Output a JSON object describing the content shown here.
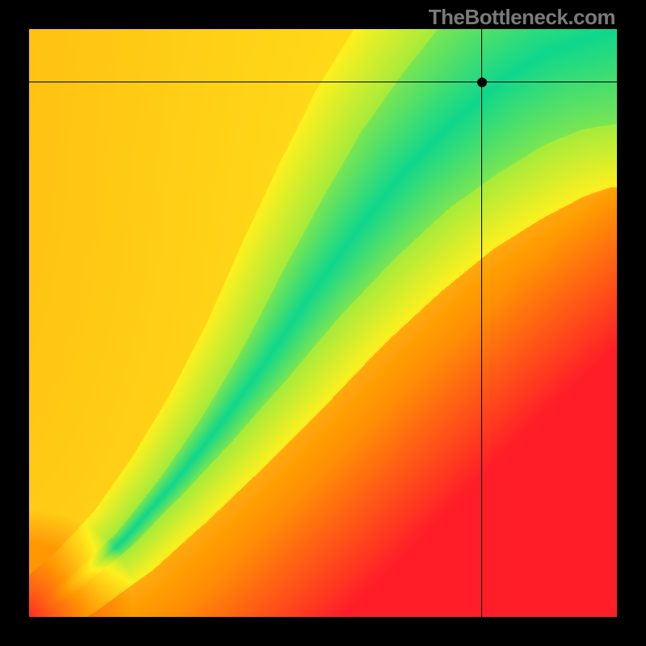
{
  "watermark": "TheBottleneck.com",
  "chart_data": {
    "type": "heatmap",
    "title": "",
    "xlabel": "",
    "ylabel": "",
    "xlim": [
      0,
      100
    ],
    "ylim": [
      0,
      100
    ],
    "grid": false,
    "legend": false,
    "colorscale_notes": "value 0 = red, 0.5 = yellow/orange, 1.0 = green (bottleneck fit). Nonlinear optimal ridge from bottom-left toward upper-center.",
    "marker": {
      "x": 77,
      "y": 91
    },
    "crosshair": {
      "x": 77,
      "y": 91
    },
    "ridge_points": [
      {
        "x": 0,
        "y": 0
      },
      {
        "x": 8,
        "y": 6
      },
      {
        "x": 16,
        "y": 13
      },
      {
        "x": 24,
        "y": 22
      },
      {
        "x": 32,
        "y": 32
      },
      {
        "x": 40,
        "y": 43
      },
      {
        "x": 48,
        "y": 55
      },
      {
        "x": 56,
        "y": 66
      },
      {
        "x": 64,
        "y": 76
      },
      {
        "x": 72,
        "y": 84
      },
      {
        "x": 80,
        "y": 91
      },
      {
        "x": 88,
        "y": 96
      },
      {
        "x": 100,
        "y": 100
      }
    ],
    "ridge_width_estimate": 7,
    "field_resolution": 128
  }
}
